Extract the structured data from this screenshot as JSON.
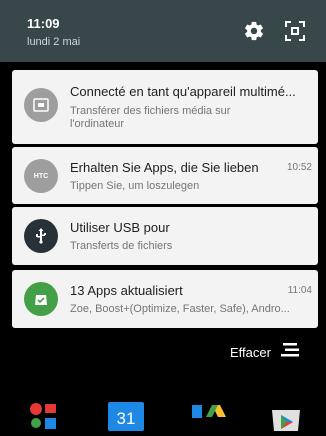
{
  "header": {
    "time": "11:09",
    "date": "lundi 2 mai"
  },
  "notifications": [
    {
      "title": "Connecté en tant qu'appareil multimé...",
      "subtitle": "Transférer des fichiers média sur l'ordinateur",
      "time": "",
      "icon": "usb-media-icon"
    },
    {
      "title": "Erhalten Sie Apps, die Sie lieben",
      "subtitle": "Tippen Sie, um loszulegen",
      "time": "10:52",
      "icon": "htc-icon",
      "icon_text": "HTC"
    },
    {
      "title": "Utiliser USB pour",
      "subtitle": "Transferts de fichiers",
      "time": "",
      "icon": "usb-icon"
    },
    {
      "title": "13 Apps aktualisiert",
      "subtitle": "Zoe, Boost+(Optimize, Faster, Safe), Andro...",
      "time": "11:04",
      "icon": "play-store-update-icon"
    }
  ],
  "clear_label": "Effacer",
  "dock": {
    "calendar_day": "31"
  },
  "colors": {
    "header_bg": "#37474a",
    "card_bg": "#f3f3f3",
    "update_green": "#43a047"
  }
}
